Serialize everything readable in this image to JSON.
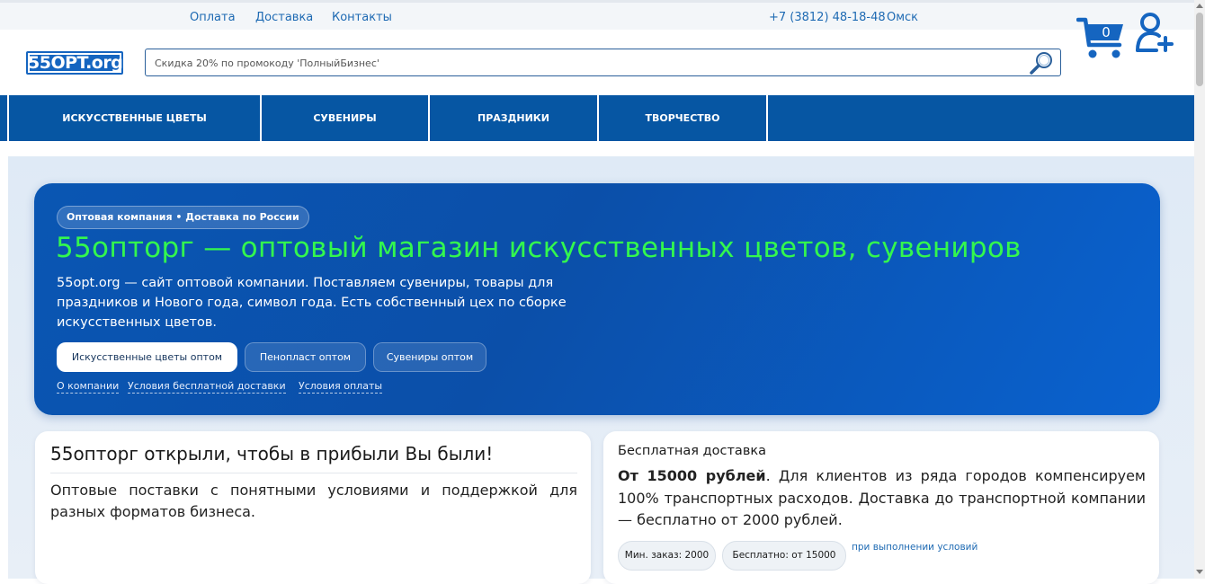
{
  "topbar": {
    "links": [
      "Оплата",
      "Доставка",
      "Контакты"
    ],
    "phone": "+7 (3812) 48-18-48",
    "city": "Омск"
  },
  "header": {
    "logo_text": "55OPT.org",
    "search_placeholder": "Скидка 20% по промокоду 'ПолныйБизнес'",
    "cart_count": "0",
    "icons": {
      "search": "search-icon",
      "cart": "cart-icon",
      "user": "user-add-icon"
    }
  },
  "nav": {
    "items": [
      "ИСКУССТВЕННЫЕ ЦВЕТЫ",
      "СУВЕНИРЫ",
      "ПРАЗДНИКИ",
      "ТВОРЧЕСТВО"
    ]
  },
  "hero": {
    "badge": "Оптовая компания • Доставка по России",
    "title": "55опторг — оптовый магазин искусственных цветов, сувениров",
    "description": "55opt.org — сайт оптовой компании. Поставляем сувениры, товары для праздников и Нового года, символ года. Есть собственный цех по сборке искусственных цветов.",
    "buttons": [
      "Искусственные цветы оптом",
      "Пенопласт оптом",
      "Сувениры оптом"
    ],
    "links": [
      "О компании",
      "Условия бесплатной доставки",
      "Условия оплаты"
    ]
  },
  "card_left": {
    "title": "55опторг открыли, чтобы в прибыли Вы были!",
    "text": "Оптовые поставки с понятными условиями и поддержкой для разных форматов бизнеса."
  },
  "card_right": {
    "title": "Бесплатная доставка",
    "text_bold": "От 15000 рублей",
    "text_rest": ". Для клиентов из ряда городов компенсируем 100% транспортных расходов. Доставка до транспортной компании — бесплатно от 2000 рублей.",
    "chips": [
      "Мин. заказ: 2000",
      "Бесплатно: от 15000"
    ],
    "note": "при выполнении условий"
  },
  "colors": {
    "brand_blue": "#0656a3",
    "hero_title_green": "#33f74e",
    "link_blue": "#1e6ab3"
  }
}
